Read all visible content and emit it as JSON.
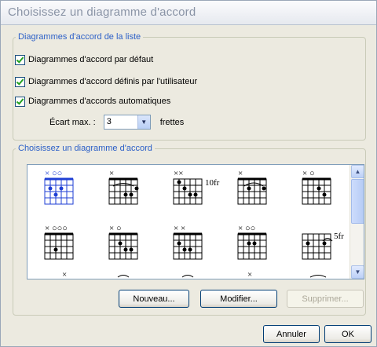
{
  "dialog": {
    "title": "Choisissez un diagramme d'accord"
  },
  "list_group": {
    "legend": "Diagrammes d'accord de la liste",
    "checkboxes": [
      {
        "label": "Diagrammes d'accord par défaut",
        "checked": true
      },
      {
        "label": "Diagrammes d'accord définis par l'utilisateur",
        "checked": true
      },
      {
        "label": "Diagrammes d'accords automatiques",
        "checked": true
      }
    ],
    "ecart_label": "Écart max. :",
    "ecart_value": "3",
    "ecart_unit": "frettes"
  },
  "choose_group": {
    "legend": "Choisissez un diagramme d'accord",
    "diagrams": [
      {
        "name": "chord-1",
        "selected": true,
        "markers": "×  ○○",
        "fret_label": ""
      },
      {
        "name": "chord-2",
        "selected": false,
        "markers": "×",
        "fret_label": ""
      },
      {
        "name": "chord-3",
        "selected": false,
        "markers": "××",
        "fret_label": "10fr"
      },
      {
        "name": "chord-4",
        "selected": false,
        "markers": "×",
        "fret_label": ""
      },
      {
        "name": "chord-5",
        "selected": false,
        "markers": "×  ○",
        "fret_label": ""
      },
      {
        "name": "chord-6",
        "selected": false,
        "markers": "× ○○○",
        "fret_label": ""
      },
      {
        "name": "chord-7",
        "selected": false,
        "markers": "×  ○",
        "fret_label": ""
      },
      {
        "name": "chord-8",
        "selected": false,
        "markers": "×  ×",
        "fret_label": ""
      },
      {
        "name": "chord-9",
        "selected": false,
        "markers": "×  ○○",
        "fret_label": ""
      },
      {
        "name": "chord-10",
        "selected": false,
        "markers": "",
        "fret_label": "5fr"
      }
    ],
    "buttons": {
      "new": "Nouveau...",
      "edit": "Modifier...",
      "delete": "Supprimer..."
    }
  },
  "footer": {
    "cancel": "Annuler",
    "ok": "OK"
  },
  "colors": {
    "legend": "#2b5fc7",
    "selection": "#1f3fd4"
  }
}
